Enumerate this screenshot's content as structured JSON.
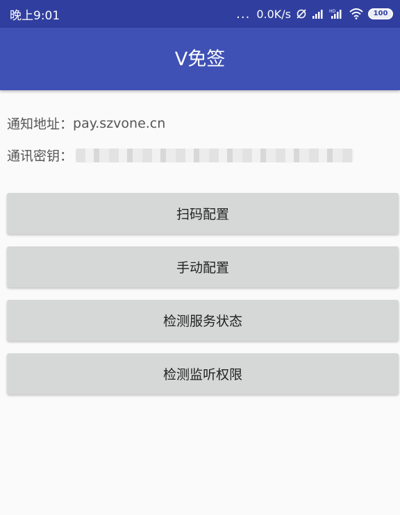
{
  "status_bar": {
    "time": "晚上9:01",
    "dots": "...",
    "network_speed": "0.0K/s",
    "battery": "100",
    "icons": [
      "notification-icon",
      "signal-icon",
      "hd-signal-icon",
      "wifi-icon",
      "battery-icon"
    ]
  },
  "app_bar": {
    "title": "V免签"
  },
  "info": {
    "notify_address_label": "通知地址：",
    "notify_address_value": "pay.szvone.cn",
    "secret_key_label": "通讯密钥："
  },
  "buttons": {
    "scan_config": "扫码配置",
    "manual_config": "手动配置",
    "check_service_status": "检测服务状态",
    "check_listen_permission": "检测监听权限"
  },
  "colors": {
    "status_bar": "#303f9f",
    "app_bar": "#3f51b5",
    "button_bg": "#d6d7d7",
    "page_bg": "#fafafa"
  }
}
